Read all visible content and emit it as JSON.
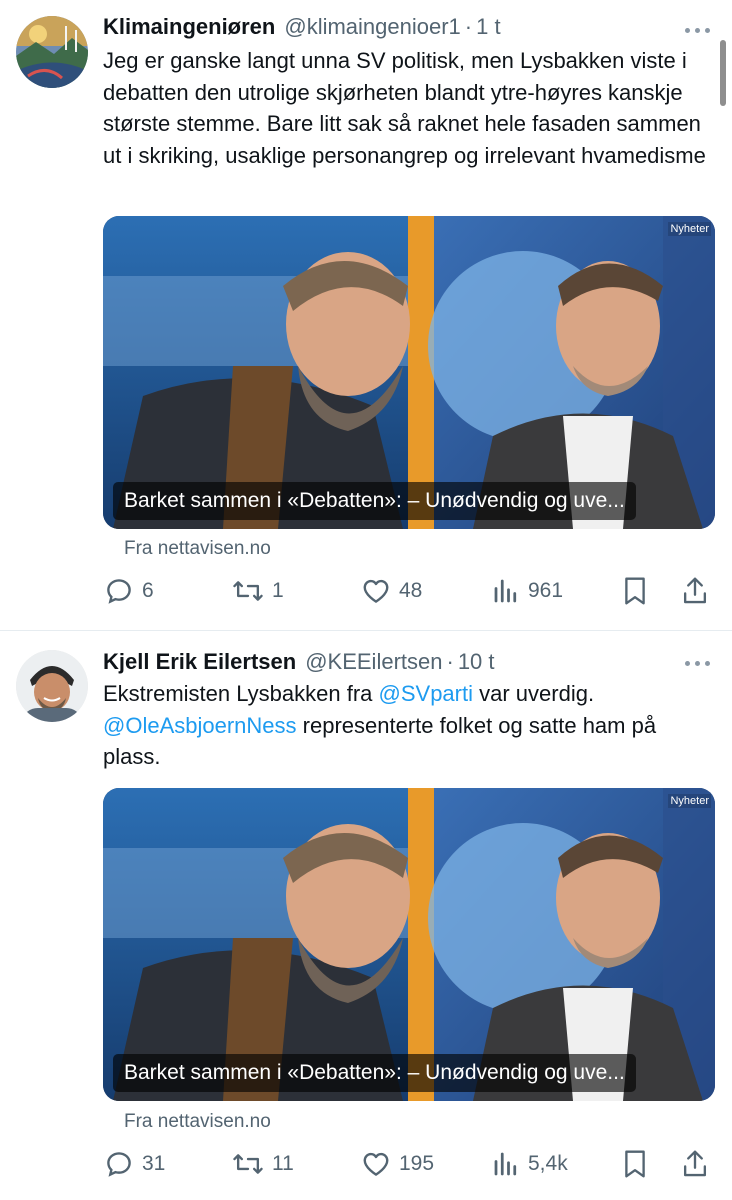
{
  "tweets": [
    {
      "display_name": "Klimaingeniøren",
      "handle": "@klimaingenioer1",
      "separator": "·",
      "time": "1 t",
      "text": "Jeg er ganske langt unna SV politisk, men Lysbakken viste i debatten den utrolige skjørheten blandt ytre-høyres kanskje største stemme. Bare litt sak så raknet hele fasaden sammen ut i skriking, usaklige personangrep og irrelevant hvamedisme",
      "card": {
        "title": "Barket sammen i «Debatten»: – Unødvendig og uve...",
        "badge": "Nyheter"
      },
      "source": "Fra nettavisen.no",
      "actions": {
        "replies": "6",
        "reposts": "1",
        "likes": "48",
        "views": "961"
      }
    },
    {
      "display_name": "Kjell Erik Eilertsen",
      "handle": "@KEEilertsen",
      "separator": "·",
      "time": "10 t",
      "text_before": "Ekstremisten Lysbakken fra ",
      "mention1": "@SVparti",
      "text_middle": " var uverdig.",
      "mention2": "@OleAsbjoernNess",
      "text_after": " representerte folket og satte ham på plass.",
      "card": {
        "title": "Barket sammen i «Debatten»: – Unødvendig og uve...",
        "badge": "Nyheter"
      },
      "source": "Fra nettavisen.no",
      "actions": {
        "replies": "31",
        "reposts": "11",
        "likes": "195",
        "views": "5,4k"
      }
    }
  ],
  "colors": {
    "text": "#0f1419",
    "secondary": "#536471",
    "link": "#1d9bf0",
    "divider": "#e6ecf0"
  },
  "icons": [
    "more-icon",
    "reply-icon",
    "repost-icon",
    "like-icon",
    "views-icon",
    "bookmark-icon",
    "share-icon"
  ]
}
